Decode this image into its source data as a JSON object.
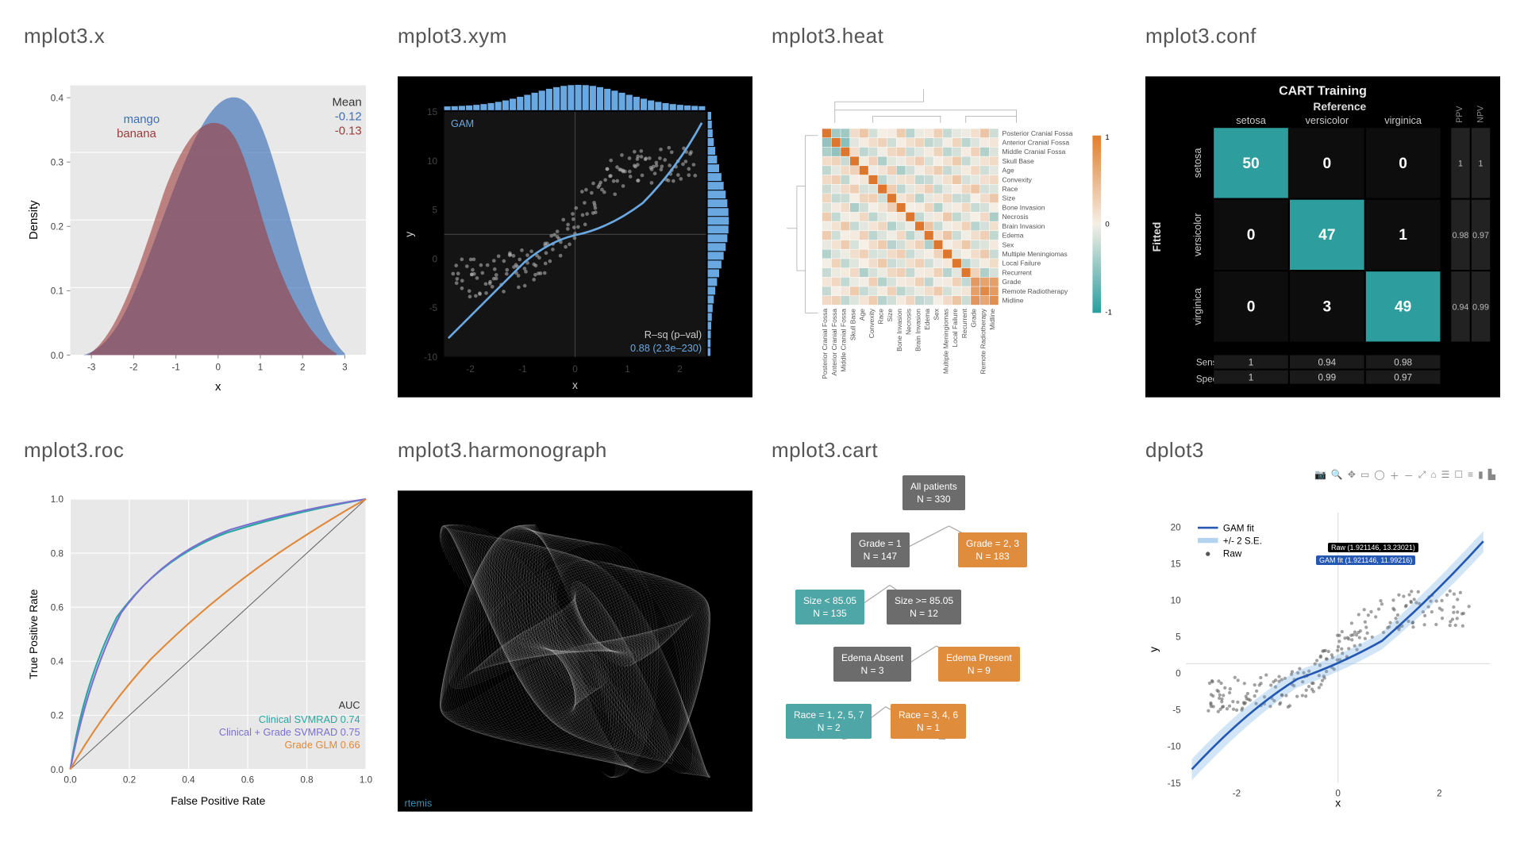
{
  "panels": {
    "density": {
      "title": "mplot3.x"
    },
    "xym": {
      "title": "mplot3.xym"
    },
    "heat": {
      "title": "mplot3.heat"
    },
    "conf": {
      "title": "mplot3.conf"
    },
    "roc": {
      "title": "mplot3.roc"
    },
    "harmono": {
      "title": "mplot3.harmonograph"
    },
    "cart": {
      "title": "mplot3.cart"
    },
    "dplot": {
      "title": "dplot3"
    }
  },
  "chart_data": [
    {
      "id": "density",
      "type": "area",
      "xlabel": "x",
      "ylabel": "Density",
      "xlim": [
        -3.5,
        3.5
      ],
      "ylim": [
        0,
        0.42
      ],
      "xticks": [
        -3,
        -2,
        -1,
        0,
        1,
        2,
        3
      ],
      "yticks": [
        0.0,
        0.1,
        0.2,
        0.3,
        0.4
      ],
      "series": [
        {
          "name": "mango",
          "color": "#3b6fb6",
          "mean": -0.12
        },
        {
          "name": "banana",
          "color": "#9c3b3b",
          "mean": -0.13
        }
      ],
      "mean_label": "Mean"
    },
    {
      "id": "xym",
      "type": "scatter",
      "xlabel": "x",
      "ylabel": "y",
      "xlim": [
        -2.5,
        2.5
      ],
      "ylim": [
        -10,
        15
      ],
      "xticks": [
        -2,
        -1,
        0,
        1,
        2
      ],
      "yticks": [
        -10,
        -5,
        0,
        5,
        10,
        15
      ],
      "fit_label": "GAM",
      "rsq_label": "R–sq (p–val)",
      "rsq_value": "0.88 (2.3e–230)",
      "marginal_bars": 36
    },
    {
      "id": "heat",
      "type": "heatmap",
      "categories": [
        "Posterior Cranial Fossa",
        "Anterior Cranial Fossa",
        "Middle Cranial Fossa",
        "Skull Base",
        "Age",
        "Convexity",
        "Race",
        "Size",
        "Bone Invasion",
        "Necrosis",
        "Brain Invasion",
        "Edema",
        "Sex",
        "Multiple Meningiomas",
        "Local Failure",
        "Recurrent",
        "Grade",
        "Remote Radiotherapy",
        "Midline"
      ],
      "colorbar": {
        "min": -1.0,
        "mid": 0.0,
        "max": 1.0,
        "low_color": "#2a9d9d",
        "mid_color": "#f5efe6",
        "high_color": "#e07e2d"
      }
    },
    {
      "id": "conf",
      "type": "table",
      "title": "CART Training",
      "axis_fitted": "Fitted",
      "axis_reference": "Reference",
      "classes": [
        "setosa",
        "versicolor",
        "virginica"
      ],
      "matrix": [
        [
          50,
          0,
          0
        ],
        [
          0,
          47,
          1
        ],
        [
          0,
          3,
          49
        ]
      ],
      "ppv_label": "PPV",
      "npv_label": "NPV",
      "ppv": [
        1,
        0.98,
        0.94
      ],
      "npv": [
        1,
        0.97,
        0.99
      ],
      "sens_label": "Sens.",
      "spec_label": "Spec.",
      "sens": [
        1,
        0.94,
        0.98
      ],
      "spec": [
        1,
        0.99,
        0.97
      ]
    },
    {
      "id": "roc",
      "type": "line",
      "xlabel": "False Positive Rate",
      "ylabel": "True Positive Rate",
      "xlim": [
        0,
        1
      ],
      "ylim": [
        0,
        1
      ],
      "xticks": [
        0.0,
        0.2,
        0.4,
        0.6,
        0.8,
        1.0
      ],
      "yticks": [
        0.0,
        0.2,
        0.4,
        0.6,
        0.8,
        1.0
      ],
      "auc_label": "AUC",
      "series": [
        {
          "name": "Clinical SVMRAD",
          "auc": 0.74,
          "color": "#2aa7a2"
        },
        {
          "name": "Clinical + Grade SVMRAD",
          "auc": 0.75,
          "color": "#7b6fd1"
        },
        {
          "name": "Grade GLM",
          "auc": 0.66,
          "color": "#e0893a"
        }
      ]
    },
    {
      "id": "harmonograph",
      "type": "line",
      "watermark": "rtemis"
    },
    {
      "id": "cart",
      "type": "table",
      "nodes": [
        {
          "id": "root",
          "label": "All patients",
          "n": "N = 330",
          "color": "gray"
        },
        {
          "id": "g1",
          "label": "Grade = 1",
          "n": "N = 147",
          "color": "gray"
        },
        {
          "id": "g23",
          "label": "Grade = 2, 3",
          "n": "N = 183",
          "color": "orange"
        },
        {
          "id": "size_lt",
          "label": "Size < 85.05",
          "n": "N = 135",
          "color": "teal"
        },
        {
          "id": "size_ge",
          "label": "Size >= 85.05",
          "n": "N = 12",
          "color": "gray"
        },
        {
          "id": "ed_abs",
          "label": "Edema Absent",
          "n": "N = 3",
          "color": "gray"
        },
        {
          "id": "ed_pres",
          "label": "Edema Present",
          "n": "N = 9",
          "color": "orange"
        },
        {
          "id": "race_a",
          "label": "Race = 1, 2, 5, 7",
          "n": "N = 2",
          "color": "teal"
        },
        {
          "id": "race_b",
          "label": "Race = 3, 4, 6",
          "n": "N = 1",
          "color": "orange"
        }
      ]
    },
    {
      "id": "dplot",
      "type": "scatter",
      "xlabel": "x",
      "ylabel": "y",
      "xlim": [
        -3,
        3
      ],
      "ylim": [
        -15,
        22
      ],
      "xticks": [
        -2,
        0,
        2
      ],
      "yticks": [
        -15,
        -10,
        -5,
        0,
        5,
        10,
        15,
        20
      ],
      "legend": [
        "GAM fit",
        "+/- 2 S.E.",
        "Raw"
      ],
      "tooltip_raw": "Raw (1.921146, 13.23021)",
      "tooltip_fit": "GAM fit (1.921146, 11.99216)",
      "toolbar_icons": [
        "camera",
        "zoom",
        "pan",
        "select",
        "lasso",
        "zoom-in",
        "zoom-out",
        "autoscale",
        "reset",
        "spike",
        "hover-closest",
        "hover-compare",
        "logo",
        "toggle"
      ]
    }
  ]
}
